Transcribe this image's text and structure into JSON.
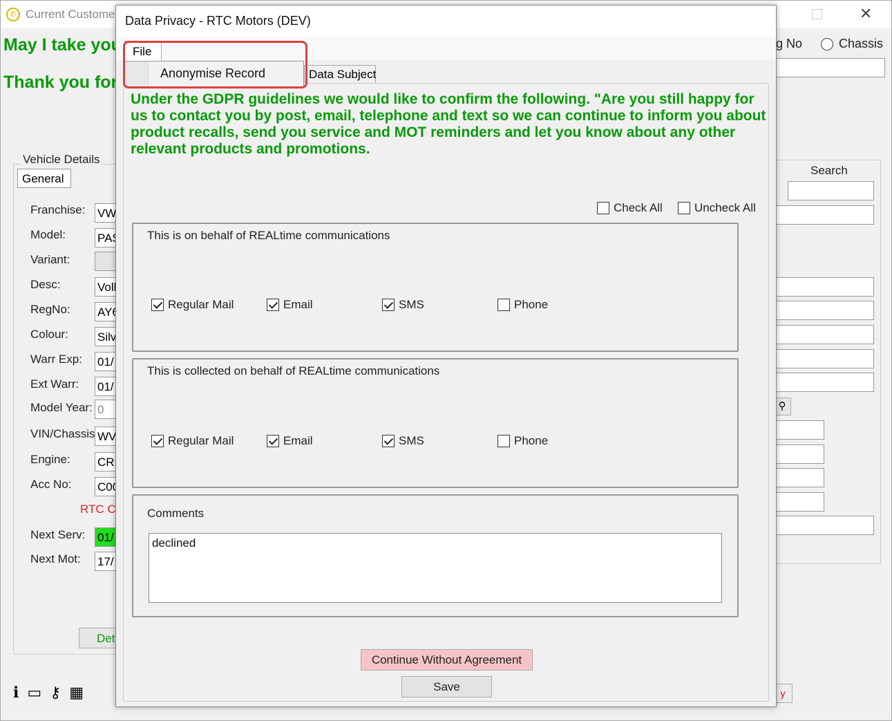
{
  "background_window": {
    "title": "Current Custome",
    "line1": "May I take you",
    "line2": "Thank you for",
    "reg_no_label": "eg No",
    "chassis_label": "Chassis",
    "vehicle_details_label": "Vehicle Details",
    "general_tab": "General",
    "fields": [
      {
        "label": "Franchise:",
        "value": "VW"
      },
      {
        "label": "Model:",
        "value": "PAS"
      },
      {
        "label": "Variant:",
        "value": ""
      },
      {
        "label": "Desc:",
        "value": "Volk"
      },
      {
        "label": "RegNo:",
        "value": "AY6"
      },
      {
        "label": "Colour:",
        "value": "Silv"
      },
      {
        "label": "Warr Exp:",
        "value": "01/"
      },
      {
        "label": "Ext Warr:",
        "value": "01/"
      },
      {
        "label": "Model Year:",
        "value": "0"
      },
      {
        "label": "VIN/Chassis",
        "value": "WV"
      },
      {
        "label": "Engine:",
        "value": "CRL"
      },
      {
        "label": "Acc No:",
        "value": "C00"
      }
    ],
    "rtc_text": "RTC C",
    "next_serv_label": "Next Serv:",
    "next_serv_value": "01/",
    "next_mot_label": "Next Mot:",
    "next_mot_value": "17/",
    "details_button": "Det",
    "search_label": "Search"
  },
  "dialog": {
    "title": "Data Privacy - RTC Motors (DEV)",
    "menu_file": "File",
    "menu_anonymise": "Anonymise Record",
    "tab_data_subject": "Data Subject",
    "gdpr_text": "Under the GDPR guidelines we would like to confirm the following. \"Are you still happy for us to contact you by post, email, telephone and text so we can continue to inform you about product recalls, send you service and MOT reminders and let you know about any other relevant products and promotions.",
    "check_all": "Check All",
    "uncheck_all": "Uncheck All",
    "group1": {
      "title": "This is on behalf of REALtime communications",
      "options": [
        {
          "label": "Regular Mail",
          "checked": true
        },
        {
          "label": "Email",
          "checked": true
        },
        {
          "label": "SMS",
          "checked": true
        },
        {
          "label": "Phone",
          "checked": false
        }
      ]
    },
    "group2": {
      "title": "This is collected on behalf of REALtime communications",
      "options": [
        {
          "label": "Regular Mail",
          "checked": true
        },
        {
          "label": "Email",
          "checked": true
        },
        {
          "label": "SMS",
          "checked": true
        },
        {
          "label": "Phone",
          "checked": false
        }
      ]
    },
    "comments_label": "Comments",
    "comments_value": "declined",
    "continue_button": "Continue Without Agreement",
    "save_button": "Save"
  },
  "colors": {
    "gdpr_green": "#0a9a0a",
    "continue_button_bg": "#f6c4c8",
    "highlight_red": "#d94040"
  }
}
